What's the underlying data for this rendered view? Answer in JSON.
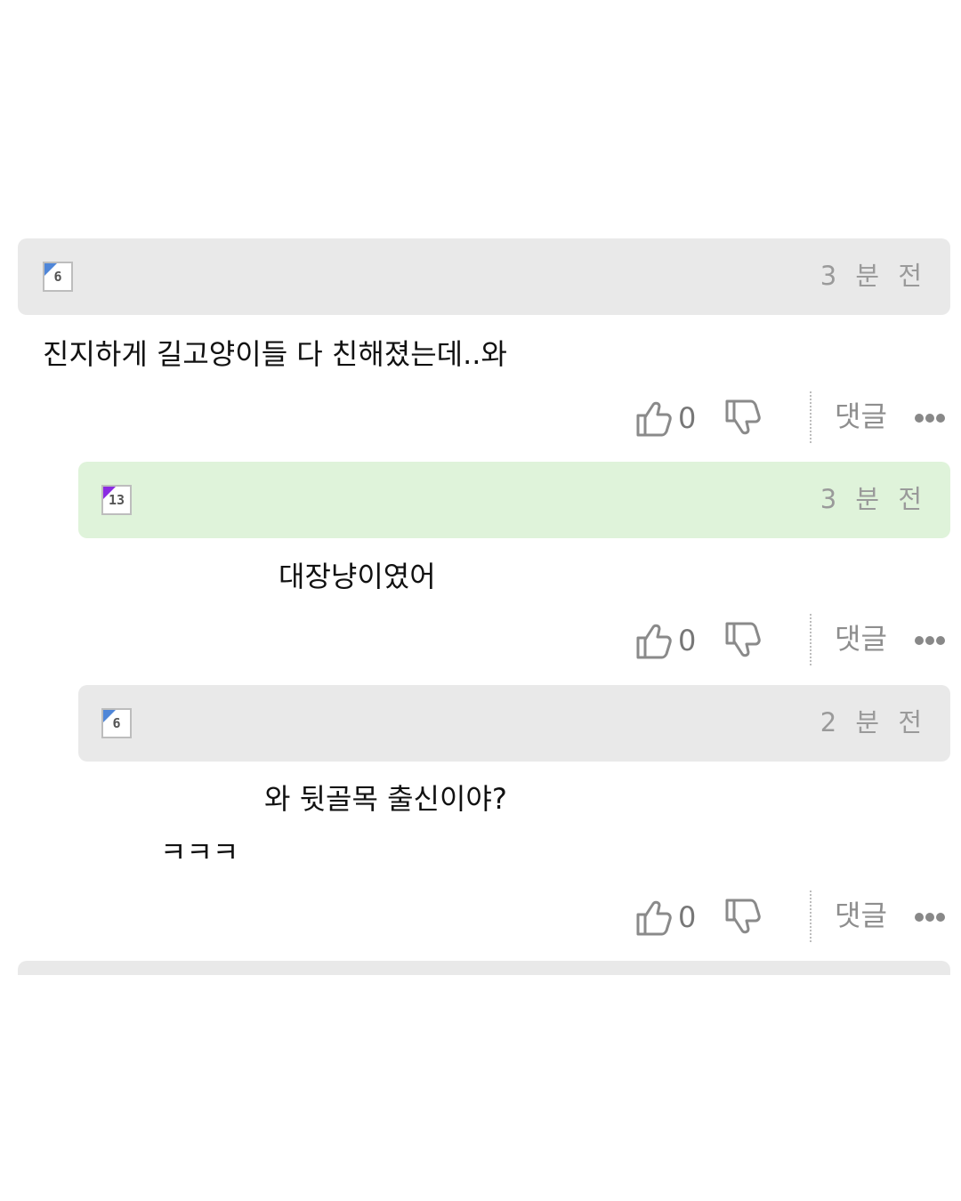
{
  "comments": [
    {
      "level": "6",
      "time": "3 분 전",
      "text": "진지하게 길고양이들 다 친해졌는데..와",
      "likes": "0",
      "reply_label": "댓글"
    },
    {
      "level": "13",
      "time": "3 분 전",
      "text": "대장냥이였어",
      "likes": "0",
      "reply_label": "댓글"
    },
    {
      "level": "6",
      "time": "2 분 전",
      "text_line1": "와 뒷골목 출신이야?",
      "text_line2": "ㅋㅋㅋ",
      "likes": "0",
      "reply_label": "댓글"
    }
  ],
  "icons": {
    "like": "thumbs-up-icon",
    "dislike": "thumbs-down-icon",
    "more": "more-dots-icon"
  },
  "colors": {
    "header_gray": "#e9e9e9",
    "header_green": "#dff3da",
    "badge_blue": "#4f86d8",
    "badge_purple": "#8a2be2"
  }
}
